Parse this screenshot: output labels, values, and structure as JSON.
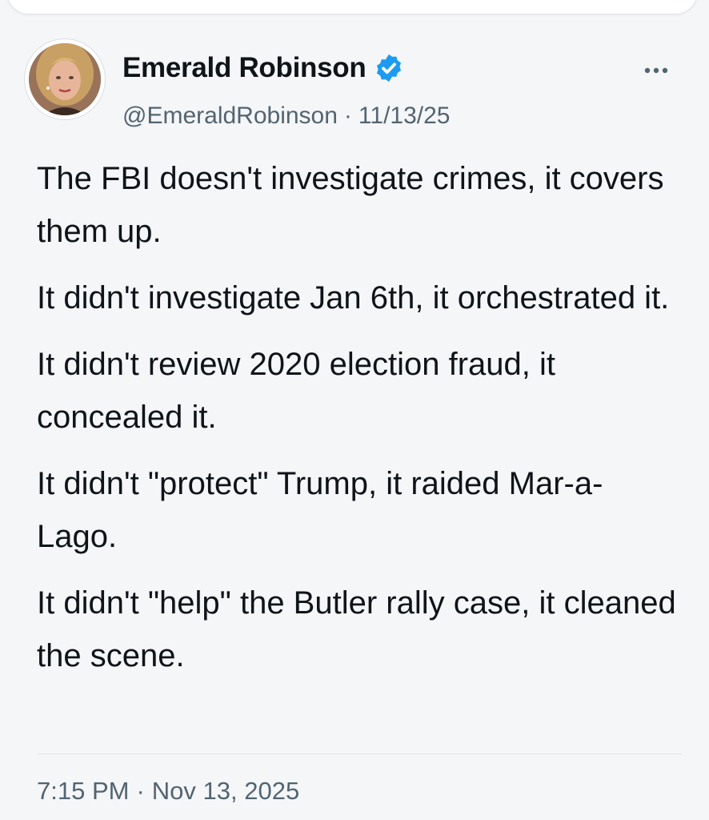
{
  "author": {
    "display_name": "Emerald Robinson",
    "handle": "@EmeraldRobinson",
    "post_date": "11/13/25",
    "verified": true,
    "verified_color": "#1d9bf0"
  },
  "meta": {
    "separator": "·"
  },
  "more_menu": {
    "icon": "more-horizontal-icon",
    "label": "···"
  },
  "tweet": {
    "paragraphs": [
      "The FBI doesn't investigate crimes, it covers them up.",
      "It didn't investigate Jan 6th, it orchestrated it.",
      "It didn't review 2020 election fraud, it concealed it.",
      "It didn't \"protect\" Trump, it raided Mar-a-Lago.",
      "It didn't \"help\" the Butler rally case, it cleaned the scene."
    ]
  },
  "footer": {
    "time": "7:15 PM",
    "separator": "·",
    "date": "Nov 13, 2025"
  }
}
